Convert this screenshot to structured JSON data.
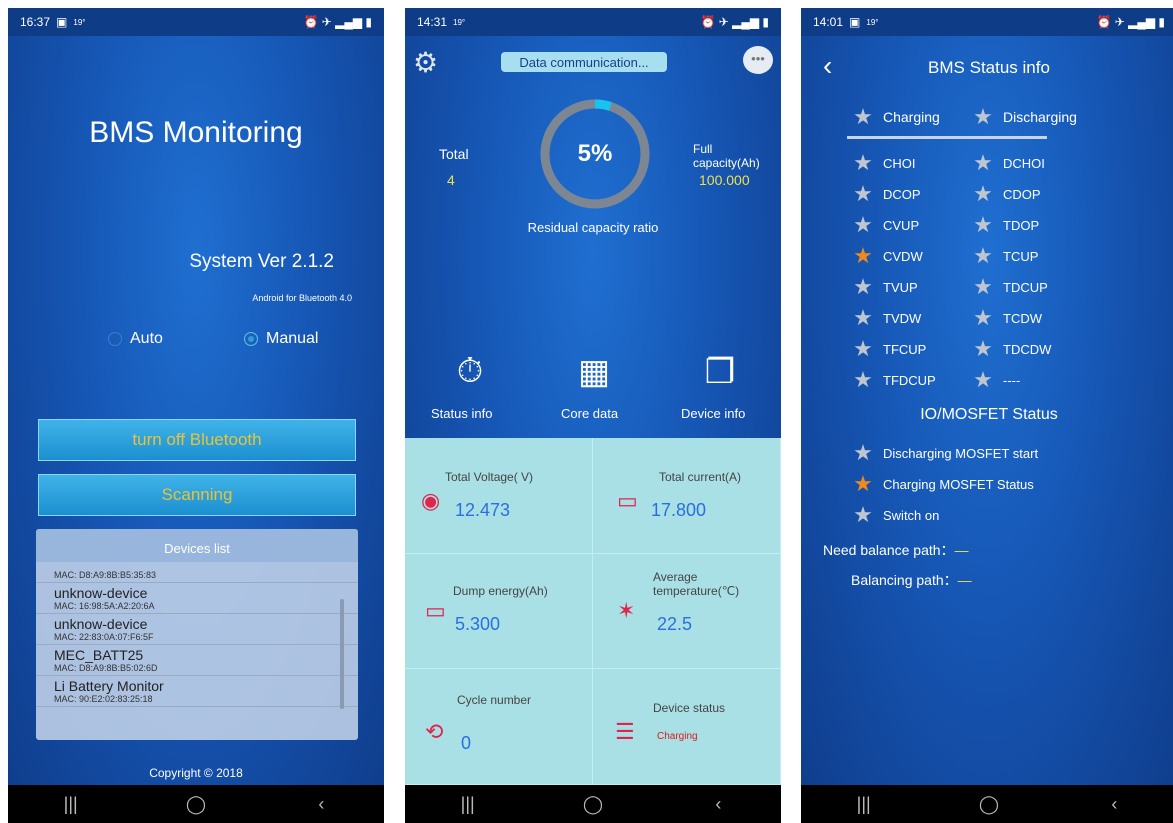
{
  "screen1": {
    "status": {
      "time": "16:37",
      "temp": "19°"
    },
    "title": "BMS Monitoring",
    "version": "System Ver 2.1.2",
    "subtitle": "Android for Bluetooth 4.0",
    "mode_auto": "Auto",
    "mode_manual": "Manual",
    "bluetooth_button": "turn off Bluetooth",
    "scan_button": "Scanning",
    "devices_header": "Devices list",
    "devices": [
      {
        "name": "",
        "mac": "MAC: D8:A9:8B:B5:35:83"
      },
      {
        "name": "unknow-device",
        "mac": "MAC: 16:98:5A:A2:20:6A"
      },
      {
        "name": "unknow-device",
        "mac": "MAC: 22:83:0A:07:F6:5F"
      },
      {
        "name": "MEC_BATT25",
        "mac": "MAC: D8:A9:8B:B5:02:6D"
      },
      {
        "name": "Li Battery Monitor",
        "mac": "MAC: 90:E2:02:83:25:18"
      }
    ],
    "copyright": "Copyright © 2018"
  },
  "screen2": {
    "status": {
      "time": "14:31",
      "temp": "19°"
    },
    "comm_label": "Data communication...",
    "total_label": "Total",
    "total_value": "4",
    "full_label": "Full capacity(Ah)",
    "full_value": "100.000",
    "percent": "5%",
    "percent_value": 5,
    "ratio_label": "Residual capacity ratio",
    "nav": {
      "status": "Status info",
      "core": "Core data",
      "device": "Device info"
    },
    "cells": {
      "voltage_label": "Total Voltage( V)",
      "voltage_value": "12.473",
      "current_label": "Total current(A)",
      "current_value": "17.800",
      "dump_label": "Dump energy(Ah)",
      "dump_value": "5.300",
      "temp_label": "Average temperature(℃)",
      "temp_value": "22.5",
      "cycle_label": "Cycle number",
      "cycle_value": "0",
      "device_label": "Device status",
      "device_value": "Charging"
    }
  },
  "screen3": {
    "status": {
      "time": "14:01",
      "temp": "19°"
    },
    "title": "BMS Status info",
    "charging": "Charging",
    "discharging": "Discharging",
    "left_flags": [
      {
        "label": "CHOI",
        "active": false
      },
      {
        "label": "DCOP",
        "active": false
      },
      {
        "label": "CVUP",
        "active": false
      },
      {
        "label": "CVDW",
        "active": true
      },
      {
        "label": "TVUP",
        "active": false
      },
      {
        "label": "TVDW",
        "active": false
      },
      {
        "label": "TFCUP",
        "active": false
      },
      {
        "label": "TFDCUP",
        "active": false
      }
    ],
    "right_flags": [
      {
        "label": "DCHOI",
        "active": false
      },
      {
        "label": "CDOP",
        "active": false
      },
      {
        "label": "TDOP",
        "active": false
      },
      {
        "label": "TCUP",
        "active": false
      },
      {
        "label": "TDCUP",
        "active": false
      },
      {
        "label": "TCDW",
        "active": false
      },
      {
        "label": "TDCDW",
        "active": false
      },
      {
        "label": "----",
        "active": false
      }
    ],
    "io_title": "IO/MOSFET Status",
    "io_items": [
      {
        "label": "Discharging MOSFET start",
        "active": false
      },
      {
        "label": "Charging MOSFET Status",
        "active": true
      },
      {
        "label": "Switch on",
        "active": false
      }
    ],
    "need_balance_label": "Need balance path：",
    "need_balance_value": "—",
    "balancing_label": "Balancing path：",
    "balancing_value": "—"
  },
  "colors": {
    "accent_yellow": "#f0e04a",
    "active_star": "#f08a1c",
    "value_blue": "#2a6fe0"
  }
}
